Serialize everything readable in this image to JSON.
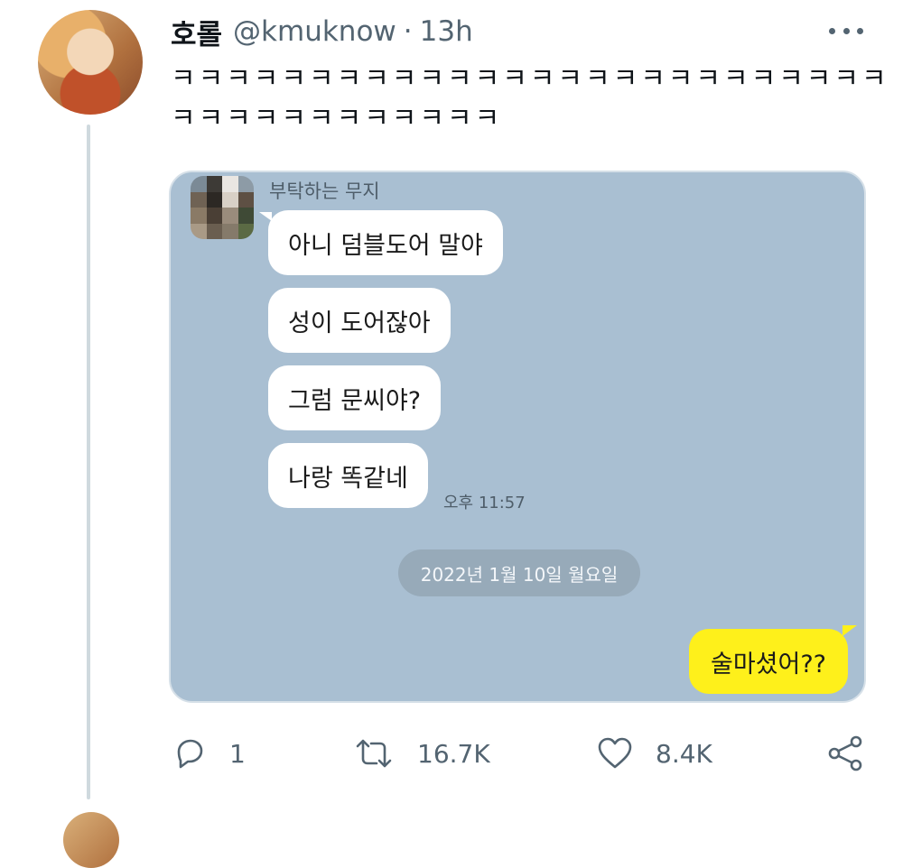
{
  "tweet": {
    "display_name": "호롤",
    "handle": "@kmuknow",
    "separator": "·",
    "time": "13h",
    "text_line1": "ㅋㅋㅋㅋㅋㅋㅋㅋㅋㅋㅋㅋㅋㅋㅋㅋㅋㅋㅋㅋㅋㅋㅋㅋㅋㅋ",
    "text_line2": "ㅋㅋㅋㅋㅋㅋㅋㅋㅋㅋㅋㅋ"
  },
  "chat": {
    "sender_name": "부탁하는 무지",
    "messages": [
      {
        "text": "아니 덤블도어 말야"
      },
      {
        "text": "성이 도어잖아"
      },
      {
        "text": "그럼 문씨야?"
      },
      {
        "text": "나랑 똑같네"
      }
    ],
    "last_message_time": "오후 11:57",
    "date_divider": "2022년 1월 10일 월요일",
    "my_message": "술마셨어??"
  },
  "actions": {
    "reply_count": "1",
    "retweet_count": "16.7K",
    "like_count": "8.4K"
  },
  "colors": {
    "chat_bg": "#a9bfd2",
    "my_bubble": "#fef01b",
    "icon_gray": "#536471"
  },
  "icons": [
    "more-icon",
    "reply-icon",
    "retweet-icon",
    "like-icon",
    "share-icon"
  ]
}
